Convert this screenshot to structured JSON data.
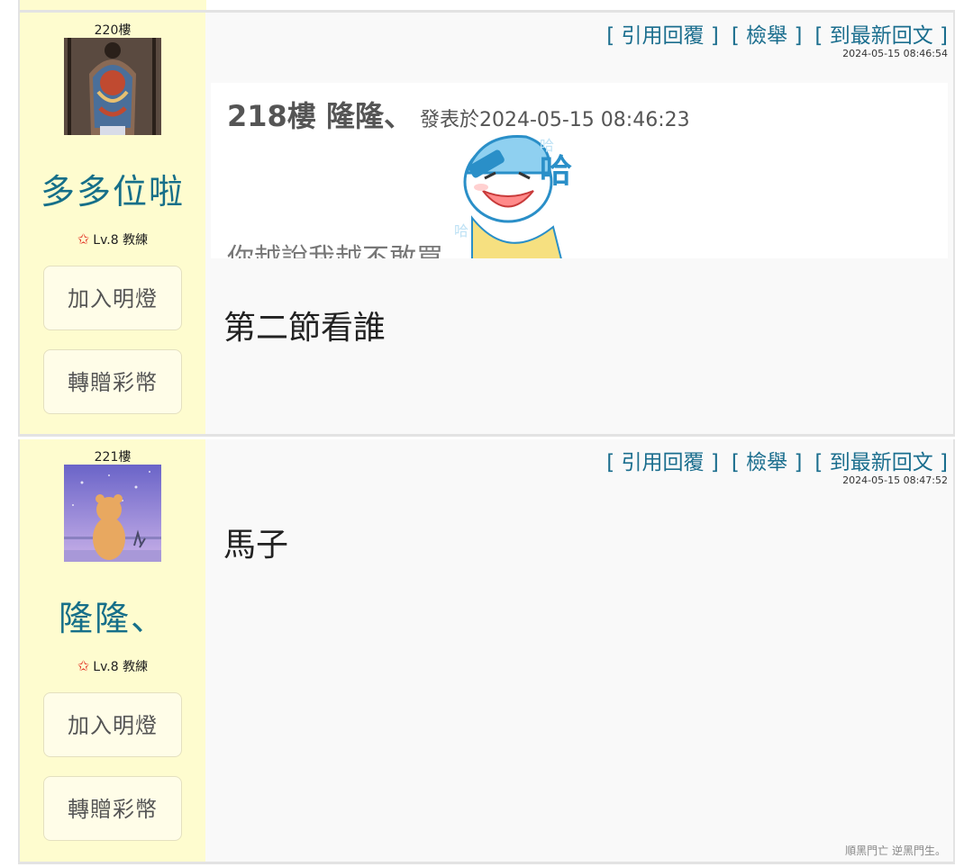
{
  "common": {
    "quote_reply": "[ 引用回覆 ]",
    "report": "[ 檢舉 ]",
    "latest": "[ 到最新回文 ]",
    "add_lamp": "加入明燈",
    "gift_coins": "轉贈彩幣"
  },
  "post1": {
    "floor": "220樓",
    "username": "多多位啦",
    "level": "Lv.8 教練",
    "timestamp": "2024-05-15 08:46:54",
    "quote": {
      "floor_user": "218樓 隆隆、",
      "posted": "發表於2024-05-15 08:46:23",
      "cut_text": "你越說我越不敢買"
    },
    "content": "第二節看誰"
  },
  "post2": {
    "floor": "221樓",
    "username": "隆隆、",
    "level": "Lv.8 教練",
    "timestamp": "2024-05-15 08:47:52",
    "content": "馬子",
    "signature": "順黑門亡 逆黑門生。"
  },
  "colors": {
    "sidebar": "#fefccf",
    "link": "#1b6e8e",
    "username": "#166f89",
    "background": "#f9f9f9"
  }
}
